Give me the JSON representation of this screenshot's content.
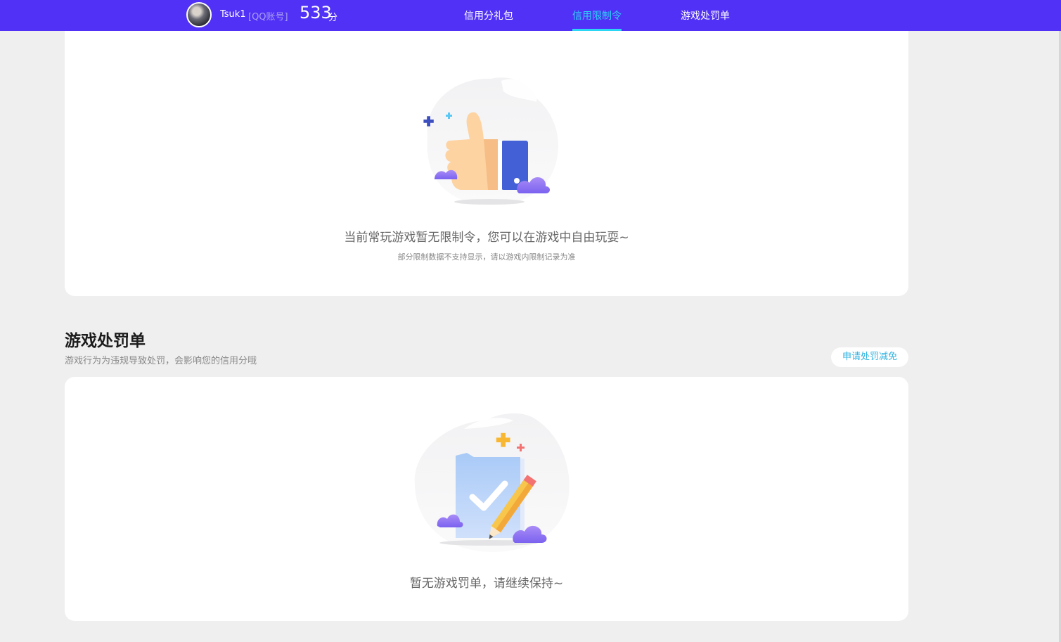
{
  "header": {
    "username": "Tsuk1",
    "account_type": "[QQ账号]",
    "score": "533",
    "score_unit": "分",
    "tabs": [
      {
        "label": "信用分礼包",
        "active": false
      },
      {
        "label": "信用限制令",
        "active": true
      },
      {
        "label": "游戏处罚单",
        "active": false
      }
    ],
    "accent_color": "#5131f6",
    "active_tab_color": "#2ad6f4"
  },
  "restriction": {
    "icon": "thumbs-up-illustration",
    "empty_text": "当前常玩游戏暂无限制令，您可以在游戏中自由玩耍~",
    "note": "部分限制数据不支持显示，请以游戏内限制记录为准"
  },
  "penalty": {
    "title": "游戏处罚单",
    "description": "游戏行为为违规导致处罚，会影响您的信用分哦",
    "appeal_button": "申请处罚减免",
    "icon": "checklist-pencil-illustration",
    "empty_text": "暂无游戏罚单，请继续保持~"
  }
}
